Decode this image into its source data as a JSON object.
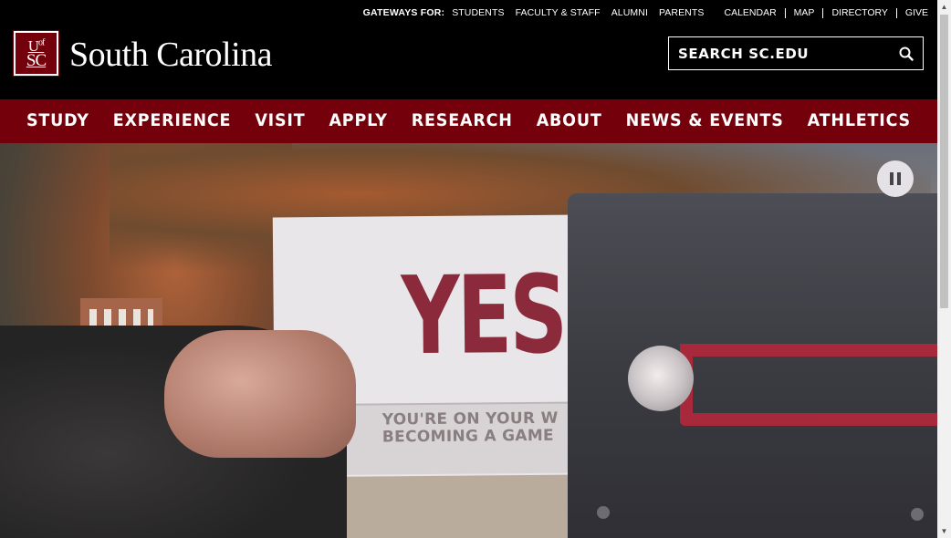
{
  "utility": {
    "gateways_label": "GATEWAYS FOR:",
    "gateways": [
      "STUDENTS",
      "FACULTY & STAFF",
      "ALUMNI",
      "PARENTS"
    ],
    "links": [
      "CALENDAR",
      "MAP",
      "DIRECTORY",
      "GIVE"
    ]
  },
  "header": {
    "logo_line1": "U",
    "logo_of": "of",
    "logo_line2": "SC",
    "wordmark": "South Carolina",
    "search_placeholder": "SEARCH SC.EDU"
  },
  "nav": {
    "items": [
      "STUDY",
      "EXPERIENCE",
      "VISIT",
      "APPLY",
      "RESEARCH",
      "ABOUT",
      "NEWS & EVENTS",
      "ATHLETICS"
    ]
  },
  "hero": {
    "card_text": "YES",
    "card_line1": "YOU'RE ON YOUR W",
    "card_line2": "BECOMING A GAME",
    "pause_icon": "pause-icon"
  },
  "colors": {
    "garnet": "#73000a",
    "black": "#000000",
    "white": "#ffffff"
  }
}
